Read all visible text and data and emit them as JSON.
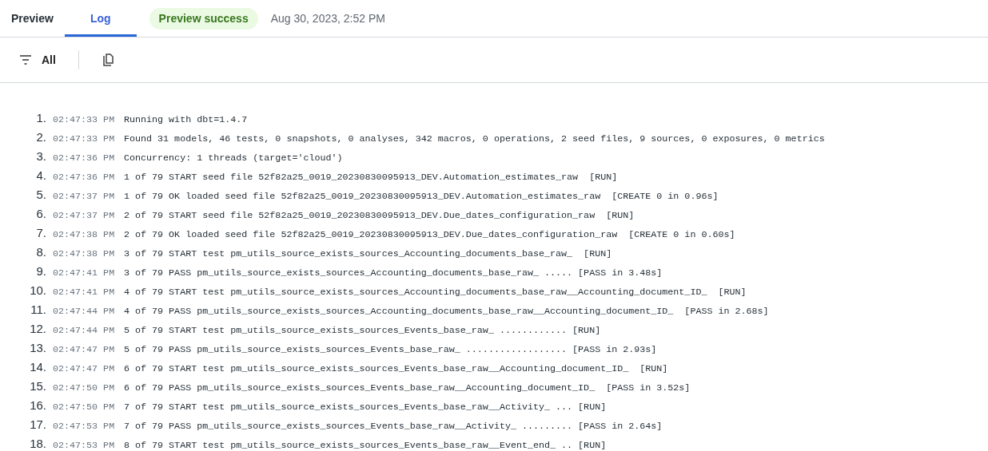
{
  "tabs": [
    {
      "label": "Preview",
      "selected": false
    },
    {
      "label": "Log",
      "selected": true
    }
  ],
  "status_badge": "Preview success",
  "timestamp": "Aug 30, 2023, 2:52 PM",
  "toolbar": {
    "filter_label": "All"
  },
  "log_lines": [
    {
      "number": "1.",
      "time": "02:47:33 PM",
      "message": "Running with dbt=1.4.7"
    },
    {
      "number": "2.",
      "time": "02:47:33 PM",
      "message": "Found 31 models, 46 tests, 0 snapshots, 0 analyses, 342 macros, 0 operations, 2 seed files, 9 sources, 0 exposures, 0 metrics"
    },
    {
      "number": "3.",
      "time": "02:47:36 PM",
      "message": "Concurrency: 1 threads (target='cloud')"
    },
    {
      "number": "4.",
      "time": "02:47:36 PM",
      "message": "1 of 79 START seed file 52f82a25_0019_20230830095913_DEV.Automation_estimates_raw  [RUN]"
    },
    {
      "number": "5.",
      "time": "02:47:37 PM",
      "message": "1 of 79 OK loaded seed file 52f82a25_0019_20230830095913_DEV.Automation_estimates_raw  [CREATE 0 in 0.96s]"
    },
    {
      "number": "6.",
      "time": "02:47:37 PM",
      "message": "2 of 79 START seed file 52f82a25_0019_20230830095913_DEV.Due_dates_configuration_raw  [RUN]"
    },
    {
      "number": "7.",
      "time": "02:47:38 PM",
      "message": "2 of 79 OK loaded seed file 52f82a25_0019_20230830095913_DEV.Due_dates_configuration_raw  [CREATE 0 in 0.60s]"
    },
    {
      "number": "8.",
      "time": "02:47:38 PM",
      "message": "3 of 79 START test pm_utils_source_exists_sources_Accounting_documents_base_raw_  [RUN]"
    },
    {
      "number": "9.",
      "time": "02:47:41 PM",
      "message": "3 of 79 PASS pm_utils_source_exists_sources_Accounting_documents_base_raw_ ..... [PASS in 3.48s]"
    },
    {
      "number": "10.",
      "time": "02:47:41 PM",
      "message": "4 of 79 START test pm_utils_source_exists_sources_Accounting_documents_base_raw__Accounting_document_ID_  [RUN]"
    },
    {
      "number": "11.",
      "time": "02:47:44 PM",
      "message": "4 of 79 PASS pm_utils_source_exists_sources_Accounting_documents_base_raw__Accounting_document_ID_  [PASS in 2.68s]"
    },
    {
      "number": "12.",
      "time": "02:47:44 PM",
      "message": "5 of 79 START test pm_utils_source_exists_sources_Events_base_raw_ ............ [RUN]"
    },
    {
      "number": "13.",
      "time": "02:47:47 PM",
      "message": "5 of 79 PASS pm_utils_source_exists_sources_Events_base_raw_ .................. [PASS in 2.93s]"
    },
    {
      "number": "14.",
      "time": "02:47:47 PM",
      "message": "6 of 79 START test pm_utils_source_exists_sources_Events_base_raw__Accounting_document_ID_  [RUN]"
    },
    {
      "number": "15.",
      "time": "02:47:50 PM",
      "message": "6 of 79 PASS pm_utils_source_exists_sources_Events_base_raw__Accounting_document_ID_  [PASS in 3.52s]"
    },
    {
      "number": "16.",
      "time": "02:47:50 PM",
      "message": "7 of 79 START test pm_utils_source_exists_sources_Events_base_raw__Activity_ ... [RUN]"
    },
    {
      "number": "17.",
      "time": "02:47:53 PM",
      "message": "7 of 79 PASS pm_utils_source_exists_sources_Events_base_raw__Activity_ ......... [PASS in 2.64s]"
    },
    {
      "number": "18.",
      "time": "02:47:53 PM",
      "message": "8 of 79 START test pm_utils_source_exists_sources_Events_base_raw__Event_end_ .. [RUN]"
    }
  ]
}
